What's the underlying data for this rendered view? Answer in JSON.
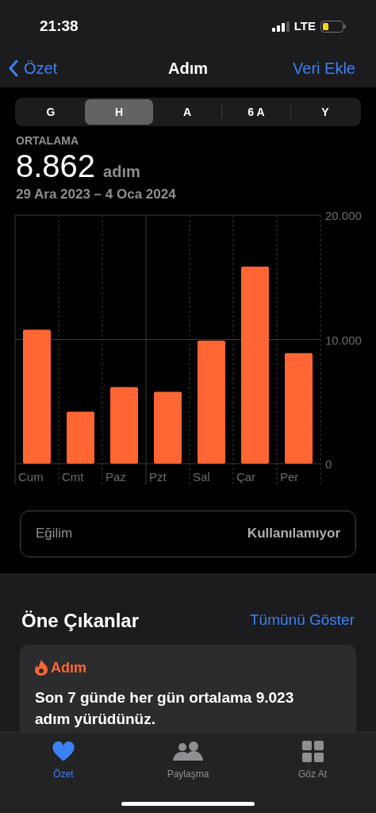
{
  "status_bar": {
    "time": "21:38",
    "network": "LTE"
  },
  "nav": {
    "back": "Özet",
    "title": "Adım",
    "action": "Veri Ekle"
  },
  "ranges": [
    {
      "label": "G",
      "selected": false
    },
    {
      "label": "H",
      "selected": true
    },
    {
      "label": "A",
      "selected": false
    },
    {
      "label": "6 A",
      "selected": false
    },
    {
      "label": "Y",
      "selected": false
    }
  ],
  "summary": {
    "label": "ORTALAMA",
    "value": "8.862",
    "unit": "adım",
    "period": "29 Ara 2023 – 4 Oca 2024"
  },
  "chart_data": {
    "type": "bar",
    "categories": [
      "Cum",
      "Cmt",
      "Paz",
      "Pzt",
      "Sal",
      "Çar",
      "Per"
    ],
    "values": [
      10790,
      4190,
      6160,
      5780,
      9900,
      15870,
      8890
    ],
    "ylim": [
      0,
      20000
    ],
    "yticks": [
      {
        "value": 0,
        "label": "0"
      },
      {
        "value": 10000,
        "label": "10.000"
      },
      {
        "value": 20000,
        "label": "20.000"
      }
    ]
  },
  "trend": {
    "label": "Eğilim",
    "value": "Kullanılamıyor"
  },
  "highlights": {
    "title": "Öne Çıkanlar",
    "action": "Tümünü Göster",
    "card": {
      "category": "Adım",
      "text": "Son 7 günde her gün ortalama 9.023 adım yürüdünüz."
    }
  },
  "tab_bar": [
    {
      "label": "Özet",
      "kind": "heart",
      "selected": true
    },
    {
      "label": "Paylaşma",
      "kind": "people",
      "selected": false
    },
    {
      "label": "Göz At",
      "kind": "grid",
      "selected": false
    }
  ]
}
